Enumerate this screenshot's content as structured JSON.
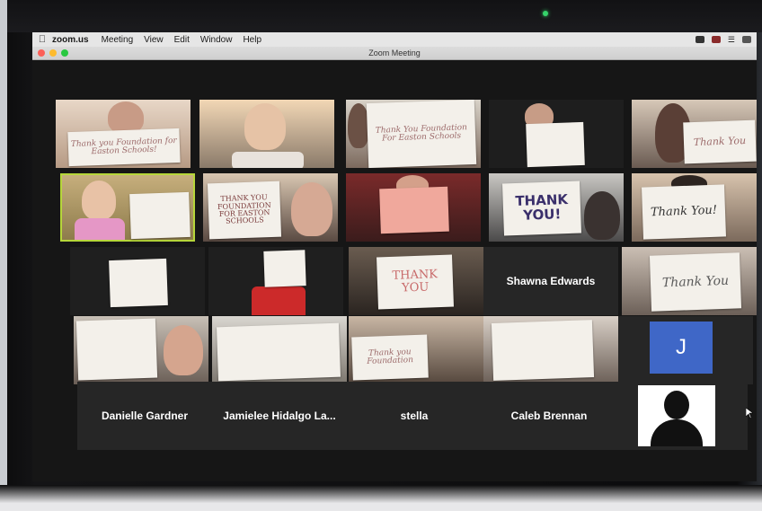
{
  "menubar": {
    "app_name": "zoom.us",
    "items": [
      "Meeting",
      "View",
      "Edit",
      "Window",
      "Help"
    ]
  },
  "window": {
    "title": "Zoom Meeting"
  },
  "signs": {
    "tile1": "Thank you Foundation for Easton Schools!",
    "tile3": "Thank You Foundation For Easton Schools",
    "tile7": "THANK YOU FOUNDATION FOR EASTON SCHOOLS",
    "tile9": "THANK YOU!",
    "tile10": "Thank You!",
    "tile13": "THANK YOU",
    "tile15": "Thank You",
    "tile18": "Thank you Foundation"
  },
  "participants": {
    "shawna": "Shawna Edwards",
    "danielle": "Danielle Gardner",
    "jamielee": "Jamielee Hidalgo La...",
    "stella": "stella",
    "caleb": "Caleb Brennan",
    "j_initial": "J"
  },
  "colors": {
    "active_speaker": "#b6d63a",
    "avatar_blue": "#3f67c7"
  }
}
